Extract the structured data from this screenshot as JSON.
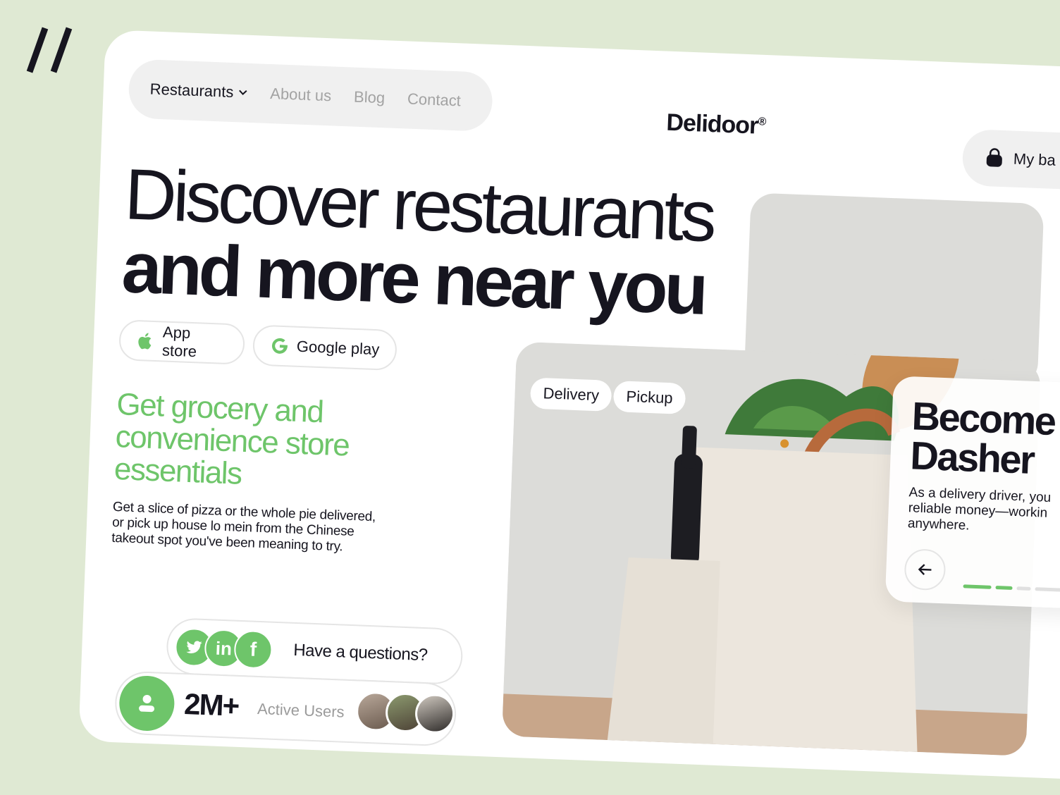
{
  "nav": {
    "items": [
      {
        "label": "Restaurants",
        "active": true
      },
      {
        "label": "About us"
      },
      {
        "label": "Blog"
      },
      {
        "label": "Contact"
      }
    ]
  },
  "brand": {
    "name": "Delidoor",
    "mark": "®"
  },
  "bag": {
    "label": "My ba"
  },
  "hero": {
    "line1": "Discover restaurants",
    "line2": "and more near you"
  },
  "stores": {
    "app": "App store",
    "google": "Google play"
  },
  "subhead": {
    "l1": "Get grocery and",
    "l2": "convenience store",
    "l3": "essentials"
  },
  "paragraph": {
    "l1": "Get a slice of pizza or the whole pie delivered,",
    "l2": "or pick up house lo mein from the Chinese",
    "l3": "takeout spot you've been meaning to try."
  },
  "social": {
    "question": "Have a questions?",
    "icons": [
      "twitter-icon",
      "linkedin-icon",
      "facebook-icon"
    ]
  },
  "users": {
    "count": "2M+",
    "label": "Active Users"
  },
  "chips": {
    "delivery": "Delivery",
    "pickup": "Pickup"
  },
  "dasher": {
    "title1": "Become",
    "title2": "Dasher",
    "desc1": "As a delivery driver, you",
    "desc2": "reliable money—workin",
    "desc3": "anywhere."
  },
  "colors": {
    "accent": "#6ec56a",
    "background": "#dfe9d3",
    "ink": "#16151f"
  }
}
